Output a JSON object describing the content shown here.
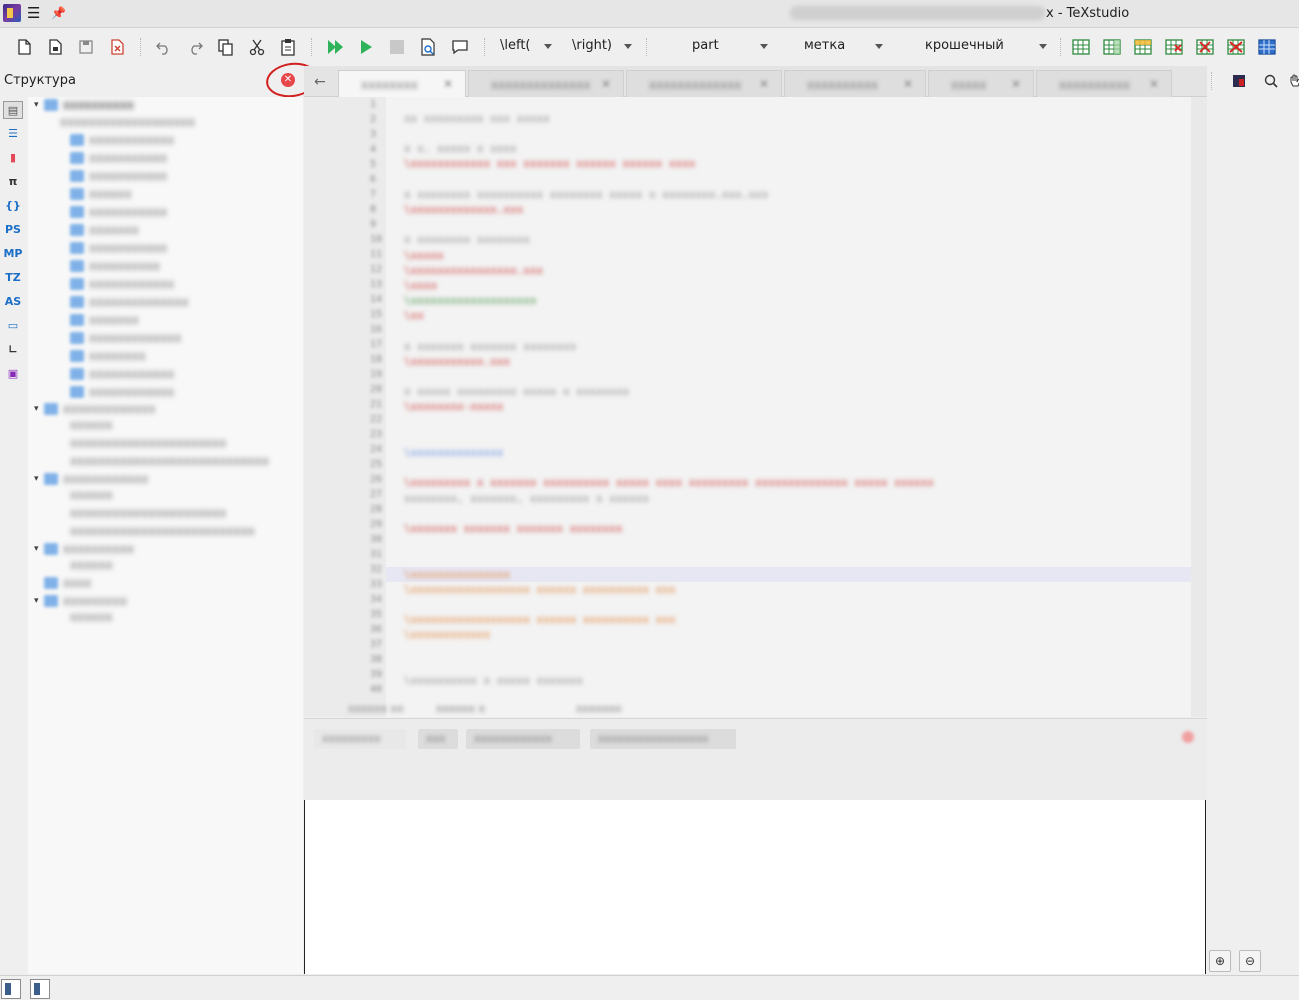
{
  "window": {
    "title": "x - TeXstudio",
    "icons": [
      "texstudio-app-icon",
      "hamburger-menu-icon",
      "pin-icon"
    ]
  },
  "toolbar": {
    "buttons": [
      "new-file-icon",
      "new-from-template-icon",
      "save-icon",
      "close-file-icon",
      "undo-icon",
      "redo-icon",
      "copy-icon",
      "cut-icon",
      "paste-icon",
      "build-and-view-icon",
      "compile-icon",
      "stop-icon",
      "view-pdf-icon",
      "comment-icon"
    ],
    "left_delim": "\\left(",
    "right_delim": "\\right)",
    "section_combo": "part",
    "label_combo": "метка",
    "size_combo": "крошечный",
    "table_buttons": [
      "table-icon",
      "table-add-col-icon",
      "table-add-row-icon",
      "table-remove-col-icon",
      "table-remove-row-icon",
      "table-delete-icon",
      "table-align-icon"
    ]
  },
  "structure": {
    "title": "Структура",
    "close_icon": "close-panel-icon",
    "side_icons": [
      {
        "name": "structure-icon",
        "glyph": "▤"
      },
      {
        "name": "toc-icon",
        "glyph": "☰"
      },
      {
        "name": "bookmark-icon",
        "glyph": "▮"
      },
      {
        "name": "math-symbols-icon",
        "glyph": "π"
      },
      {
        "name": "brackets-icon",
        "glyph": "{}"
      },
      {
        "name": "pstricks-icon",
        "glyph": "PS"
      },
      {
        "name": "metapost-icon",
        "glyph": "MP"
      },
      {
        "name": "tikz-icon",
        "glyph": "TZ"
      },
      {
        "name": "asymptote-icon",
        "glyph": "AS"
      },
      {
        "name": "beamer-icon",
        "glyph": "▭"
      },
      {
        "name": "axis-icon",
        "glyph": "∟"
      },
      {
        "name": "user-commands-icon",
        "glyph": "▣"
      }
    ]
  },
  "editor": {
    "tabs": [
      "tab-1",
      "tab-2",
      "tab-3",
      "tab-4",
      "tab-5",
      "tab-6"
    ]
  },
  "right_panel": {
    "icons": [
      "pdf-icon",
      "search-icon",
      "hand-icon"
    ],
    "bottom_icons": [
      "zoom-in-icon",
      "zoom-out-icon"
    ]
  },
  "statusbar": {
    "icons": [
      "toggle-sidebar-icon",
      "toggle-panel-icon"
    ]
  },
  "colors": {
    "accent": "#1c6fc7",
    "close": "#e8474a",
    "annotation": "#d21f1f"
  }
}
